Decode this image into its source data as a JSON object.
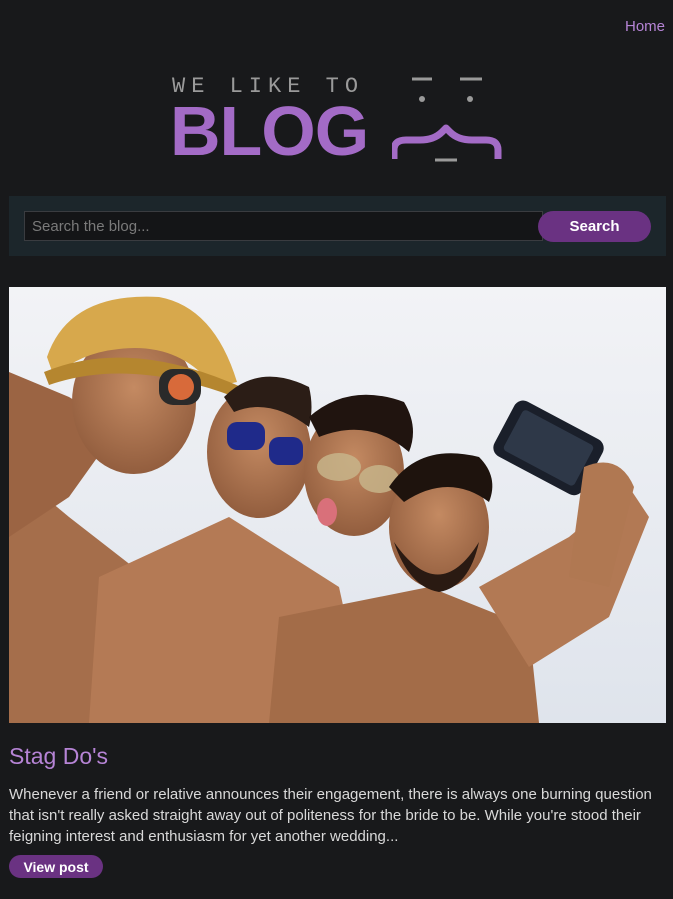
{
  "nav": {
    "home_label": "Home"
  },
  "logo": {
    "tagline": "WE LIKE TO",
    "wordmark": "BLOG"
  },
  "search": {
    "placeholder": "Search the blog...",
    "value": "",
    "button_label": "Search"
  },
  "post": {
    "image_icon": "photo-of-friends-taking-selfie",
    "title": "Stag Do's",
    "excerpt": "Whenever a friend or relative announces their engagement, there is always one burning question that isn't really asked straight away out of politeness for the bride to be. While you're stood their feigning interest and enthusiasm for yet another wedding...",
    "button_label": "View post"
  },
  "colors": {
    "background": "#18191b",
    "accent": "#a36bc6",
    "button": "#6a3282",
    "search_bar": "#1c262b"
  }
}
